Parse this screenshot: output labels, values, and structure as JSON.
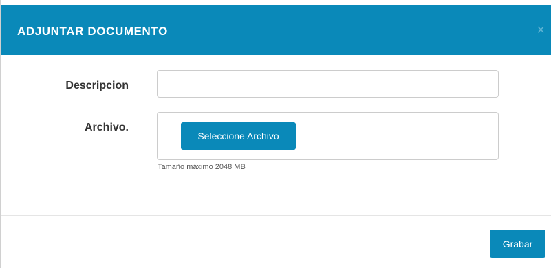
{
  "modal": {
    "title": "ADJUNTAR DOCUMENTO",
    "close_symbol": "×",
    "accent_color": "#0a89b9"
  },
  "form": {
    "description_label": "Descripcion",
    "description_value": "",
    "file_label": "Archivo.",
    "select_file_label": "Seleccione Archivo",
    "size_hint": "Tamaño máximo 2048 MB"
  },
  "footer": {
    "save_label": "Grabar"
  }
}
